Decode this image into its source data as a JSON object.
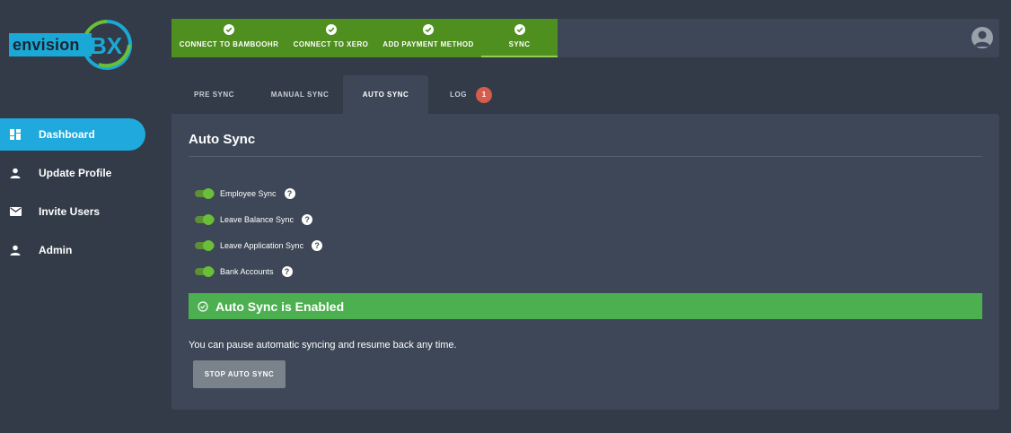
{
  "brand": {
    "name": "envision",
    "mark": "BX"
  },
  "sidebar": {
    "items": [
      {
        "label": "Dashboard",
        "icon": "dashboard-icon",
        "active": true
      },
      {
        "label": "Update Profile",
        "icon": "person-icon"
      },
      {
        "label": "Invite Users",
        "icon": "mail-icon"
      },
      {
        "label": "Admin",
        "icon": "person-icon"
      }
    ]
  },
  "steps": [
    {
      "label": "CONNECT TO BAMBOOHR",
      "done": true
    },
    {
      "label": "CONNECT TO XERO",
      "done": true
    },
    {
      "label": "ADD PAYMENT METHOD",
      "done": true
    },
    {
      "label": "SYNC",
      "done": true,
      "current": true
    }
  ],
  "tabs": [
    {
      "label": "PRE SYNC"
    },
    {
      "label": "MANUAL SYNC"
    },
    {
      "label": "AUTO SYNC",
      "active": true
    },
    {
      "label": "LOG",
      "badge": "1"
    }
  ],
  "panel": {
    "title": "Auto Sync",
    "options": [
      {
        "label": "Employee Sync",
        "enabled": true
      },
      {
        "label": "Leave Balance Sync",
        "enabled": true
      },
      {
        "label": "Leave Application Sync",
        "enabled": true
      },
      {
        "label": "Bank Accounts",
        "enabled": true
      }
    ],
    "help_glyph": "?",
    "banner": "Auto Sync is Enabled",
    "note": "You can pause automatic syncing and resume back any time.",
    "stop_button": "STOP AUTO SYNC"
  },
  "colors": {
    "accent": "#1fa9dc",
    "success": "#4caf50",
    "steps_bg": "#4e8f1f",
    "badge": "#d65c4c",
    "panel": "#3d4757",
    "background": "#323b47"
  }
}
